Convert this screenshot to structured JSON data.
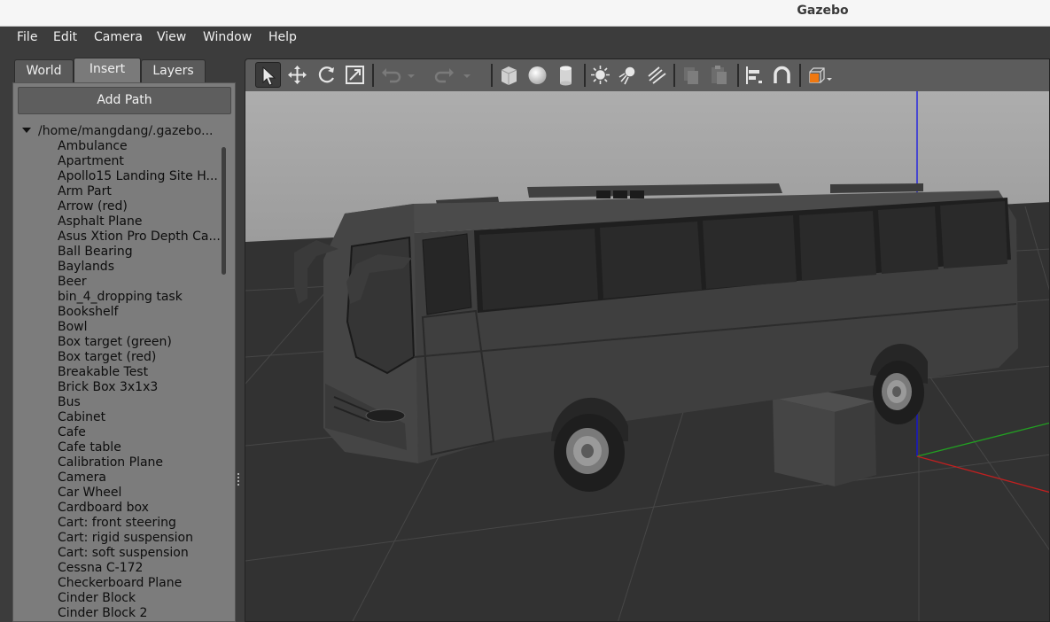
{
  "window": {
    "title": "Gazebo"
  },
  "menu": [
    "File",
    "Edit",
    "Camera",
    "View",
    "Window",
    "Help"
  ],
  "tabs": [
    "World",
    "Insert",
    "Layers"
  ],
  "active_tab": "Insert",
  "insert": {
    "add_path_label": "Add Path",
    "root_path": "/home/mangdang/.gazebo...",
    "models": [
      "Ambulance",
      "Apartment",
      "Apollo15 Landing Site H...",
      "Arm Part",
      "Arrow (red)",
      "Asphalt Plane",
      "Asus Xtion Pro Depth Ca...",
      "Ball Bearing",
      "Baylands",
      "Beer",
      "bin_4_dropping task",
      "Bookshelf",
      "Bowl",
      "Box target (green)",
      "Box target (red)",
      "Breakable Test",
      "Brick Box 3x1x3",
      "Bus",
      "Cabinet",
      "Cafe",
      "Cafe table",
      "Calibration Plane",
      "Camera",
      "Car Wheel",
      "Cardboard box",
      "Cart: front steering",
      "Cart: rigid suspension",
      "Cart: soft suspension",
      "Cessna C-172",
      "Checkerboard Plane",
      "Cinder Block",
      "Cinder Block 2"
    ]
  },
  "toolbar": [
    "select-mode-icon",
    "translate-mode-icon",
    "rotate-mode-icon",
    "scale-mode-icon",
    "undo-icon",
    "undo-history-icon",
    "redo-icon",
    "redo-history-icon",
    "box-shape-icon",
    "sphere-shape-icon",
    "cylinder-shape-icon",
    "point-light-icon",
    "spot-light-icon",
    "directional-light-icon",
    "copy-icon",
    "paste-icon",
    "align-icon",
    "snap-icon",
    "change-view-icon"
  ],
  "colors": {
    "background": "#3c3c3c",
    "tree_panel": "#7c7c7c",
    "sky": "#a9a9a9",
    "ground": "#323232",
    "axis_x": "#c82020",
    "axis_y": "#20a020",
    "axis_z": "#1010e0",
    "view_accent": "#f07810"
  }
}
